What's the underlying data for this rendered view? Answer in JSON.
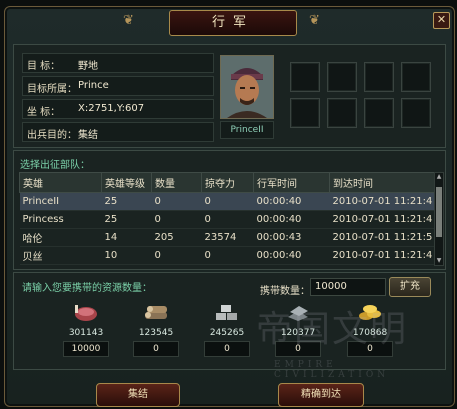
{
  "window": {
    "title": "行军",
    "close": "✕"
  },
  "info": {
    "rows": [
      {
        "key": "目    标：",
        "value": "野地"
      },
      {
        "key": "目标所属：",
        "value": "Prince"
      },
      {
        "key": "坐    标：",
        "value": "X:2751,Y:607"
      },
      {
        "key": "出兵目的：",
        "value": "集结"
      }
    ],
    "hero_name": "PrinceII"
  },
  "troops": {
    "title": "选择出征部队：",
    "columns": [
      "英雄",
      "英雄等级",
      "数量",
      "掠夺力",
      "行军时间",
      "到达时间"
    ],
    "rows": [
      [
        "PrinceII",
        "25",
        "0",
        "0",
        "00:00:40",
        "2010-07-01 11:21:4"
      ],
      [
        "Princess",
        "25",
        "0",
        "0",
        "00:00:40",
        "2010-07-01 11:21:4"
      ],
      [
        "哈伦",
        "14",
        "205",
        "23574",
        "00:00:43",
        "2010-07-01 11:21:5"
      ],
      [
        "贝丝",
        "10",
        "0",
        "0",
        "00:00:40",
        "2010-07-01 11:21:4"
      ]
    ]
  },
  "resources": {
    "prompt": "请输入您要携带的资源数量：",
    "carry_label": "携带数量：",
    "carry_value": "10000",
    "expand_label": "扩充",
    "items": [
      {
        "icon": "meat-icon",
        "amount": "301143",
        "input": "10000"
      },
      {
        "icon": "wood-icon",
        "amount": "123545",
        "input": "0"
      },
      {
        "icon": "stone-icon",
        "amount": "245265",
        "input": "0"
      },
      {
        "icon": "iron-icon",
        "amount": "120377",
        "input": "0"
      },
      {
        "icon": "gold-icon",
        "amount": "170868",
        "input": "0"
      }
    ]
  },
  "buttons": {
    "gather": "集结",
    "arrive": "精确到达"
  },
  "watermark": {
    "text": "帝国文明",
    "sub": "EMPIRE CIVILIZATION"
  }
}
